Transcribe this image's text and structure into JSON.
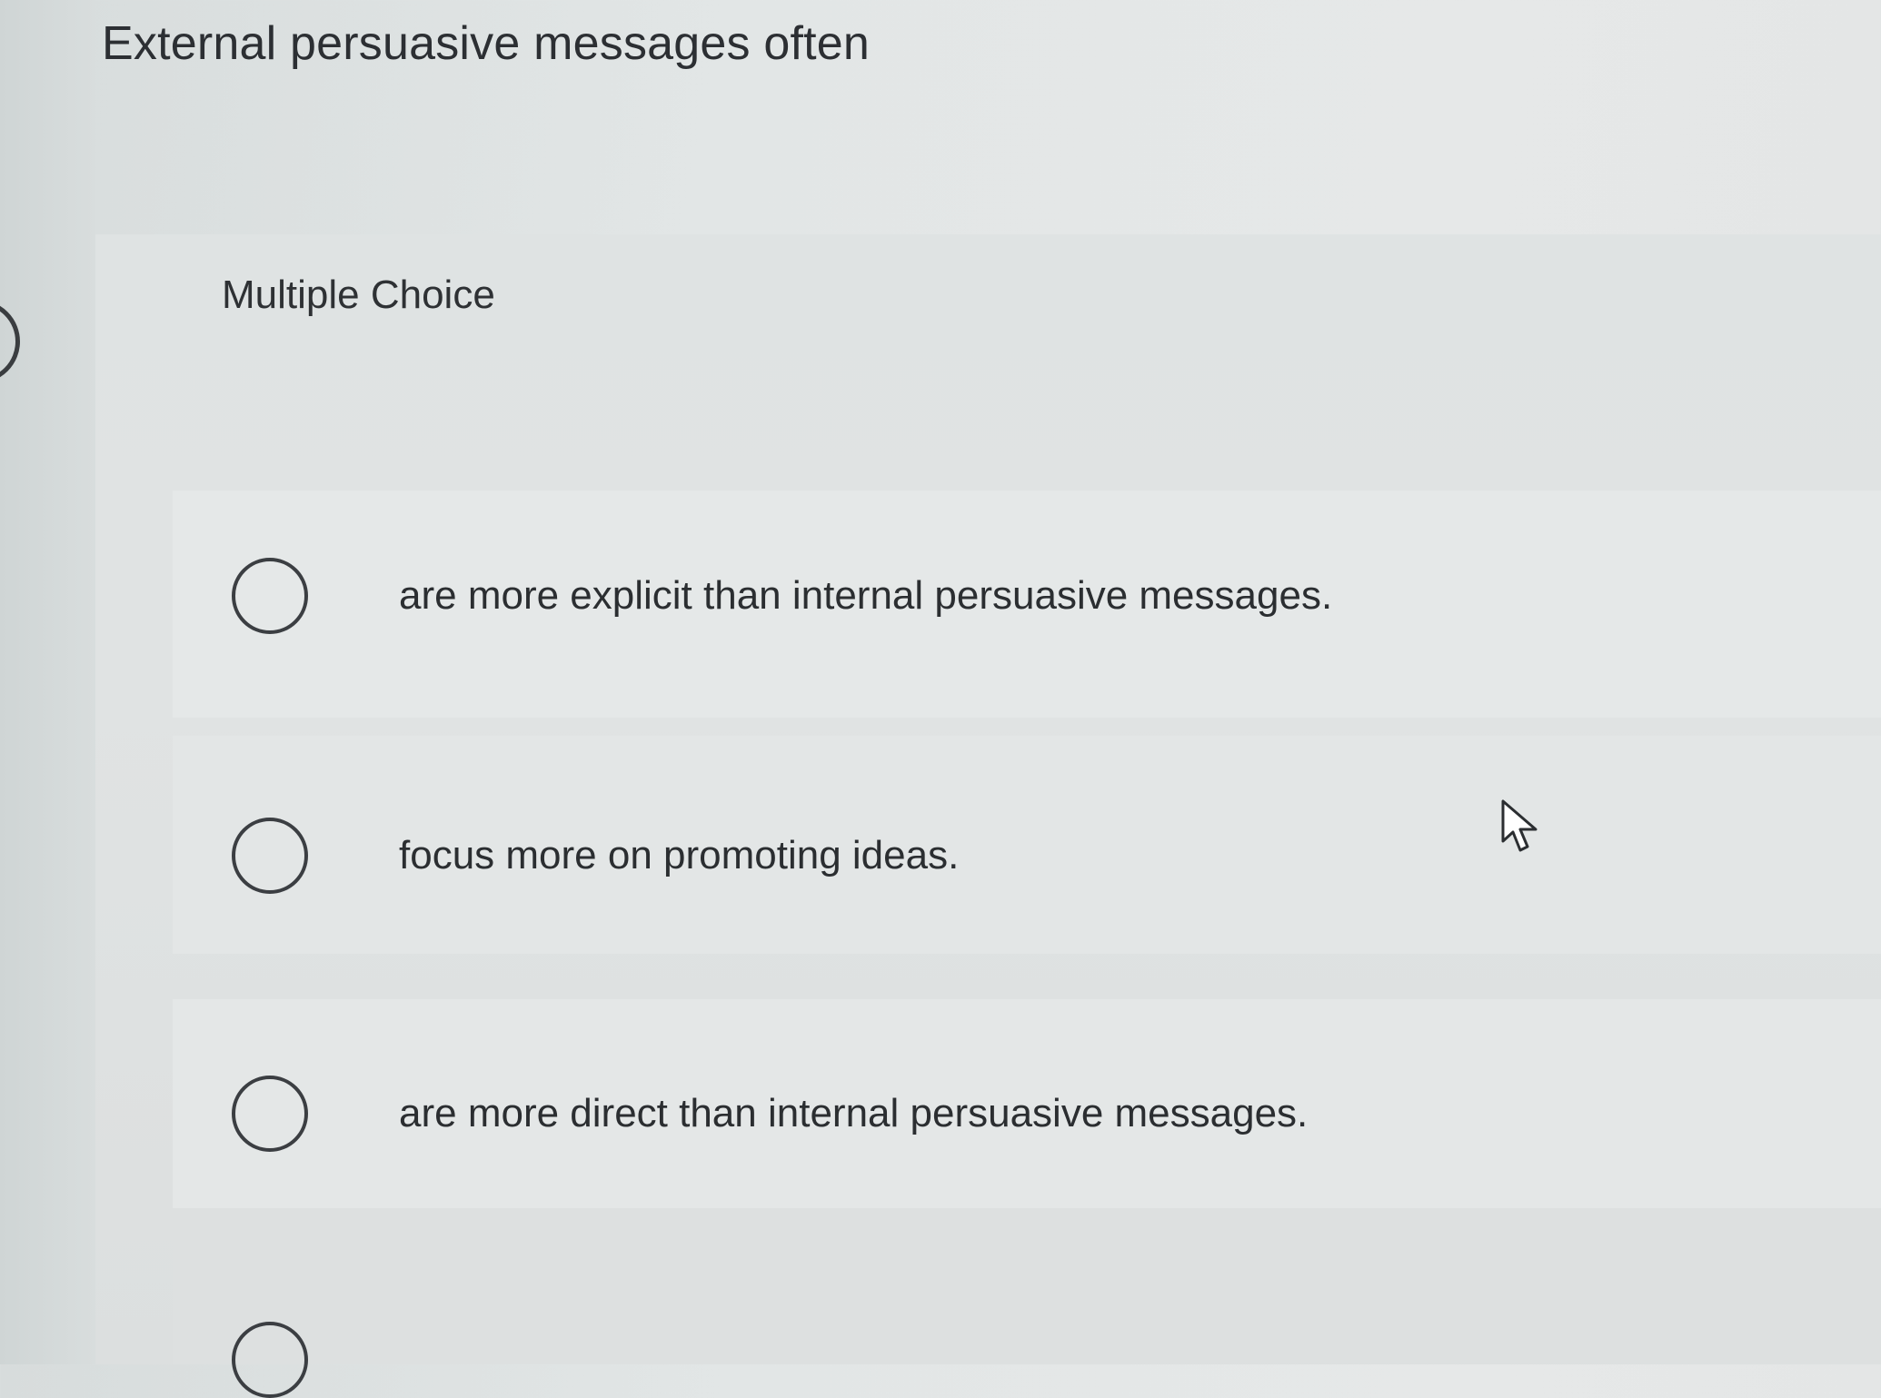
{
  "question": {
    "title": "External persuasive messages often",
    "type_label": "Multiple Choice"
  },
  "options": [
    {
      "label": "are more explicit than internal persuasive messages.",
      "selected": false
    },
    {
      "label": "focus more on promoting ideas.",
      "selected": false
    },
    {
      "label": "are more direct than internal persuasive messages.",
      "selected": false
    },
    {
      "label": "",
      "selected": false
    }
  ],
  "icons": {
    "radio": "radio-empty-icon",
    "cursor": "mouse-pointer-icon"
  }
}
